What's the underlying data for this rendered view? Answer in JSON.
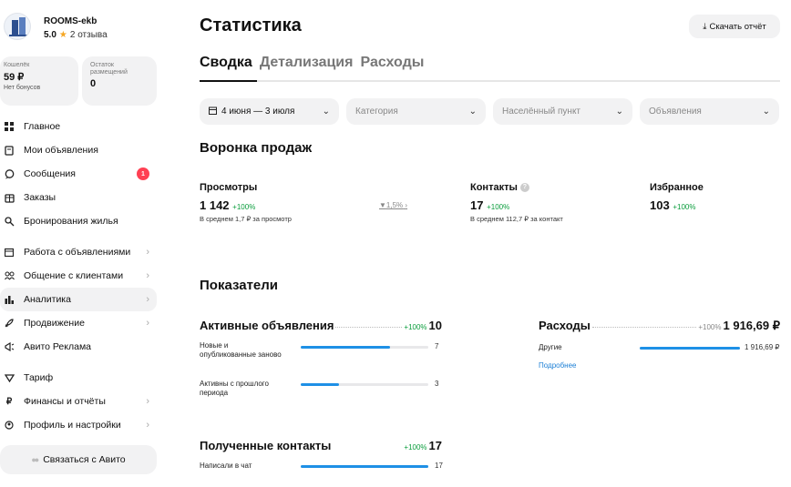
{
  "sidebar": {
    "profile": {
      "name": "ROOMS-ekb",
      "rating": "5.0",
      "reviews": "2 отзыва"
    },
    "wallet": {
      "label": "Кошелёк",
      "value": "59 ₽",
      "sub": "Нет бонусов"
    },
    "remaining": {
      "label": "Остаток размещений",
      "value": "0"
    },
    "items": [
      {
        "label": "Главное",
        "icon": "grid-icon"
      },
      {
        "label": "Мои объявления",
        "icon": "listings-icon"
      },
      {
        "label": "Сообщения",
        "icon": "chat-icon",
        "badge": "1"
      },
      {
        "label": "Заказы",
        "icon": "box-icon"
      },
      {
        "label": "Бронирования жилья",
        "icon": "booking-icon"
      },
      {
        "label": "Работа с объявлениями",
        "icon": "calendar-icon"
      },
      {
        "label": "Общение с клиентами",
        "icon": "people-icon"
      },
      {
        "label": "Аналитика",
        "icon": "analytics-icon"
      },
      {
        "label": "Продвижение",
        "icon": "rocket-icon"
      },
      {
        "label": "Авито Реклама",
        "icon": "megaphone-icon"
      },
      {
        "label": "Тариф",
        "icon": "tariff-icon"
      },
      {
        "label": "Финансы и отчёты",
        "icon": "ruble-icon"
      },
      {
        "label": "Профиль и настройки",
        "icon": "settings-icon"
      }
    ],
    "contact_button": "Связаться с Авито"
  },
  "main": {
    "title": "Статистика",
    "download": "Скачать отчёт",
    "tabs": [
      "Сводка",
      "Детализация",
      "Расходы"
    ],
    "filters": {
      "period": "4 июня — 3 июля",
      "category": "Категория",
      "city": "Населённый пункт",
      "ads": "Объявления"
    },
    "funnel": {
      "title": "Воронка продаж",
      "views": {
        "label": "Просмотры",
        "value": "1 142",
        "pct": "+100%",
        "note": "В среднем 1,7 ₽ за просмотр"
      },
      "conversion": "1,5%",
      "contacts": {
        "label": "Контакты",
        "value": "17",
        "pct": "+100%",
        "note": "В среднем 112,7 ₽ за контакт"
      },
      "favorites": {
        "label": "Избранное",
        "value": "103",
        "pct": "+100%"
      }
    },
    "metrics": {
      "title": "Показатели",
      "active": {
        "name": "Активные объявления",
        "pct": "+100%",
        "total": "10",
        "rows": [
          {
            "label": "Новые и опубликованные заново",
            "value": "7",
            "fraction": 0.7
          },
          {
            "label": "Активны с прошлого периода",
            "value": "3",
            "fraction": 0.3
          }
        ]
      },
      "expenses": {
        "name": "Расходы",
        "pct": "+100%",
        "total": "1 916,69 ₽",
        "rows": [
          {
            "label": "Другие",
            "value": "1 916,69 ₽",
            "fraction": 1.0
          }
        ],
        "more": "Подробнее"
      },
      "contacts": {
        "name": "Полученные контакты",
        "pct": "+100%",
        "total": "17",
        "rows": [
          {
            "label": "Написали в чат",
            "value": "17",
            "fraction": 1.0
          }
        ]
      }
    }
  }
}
